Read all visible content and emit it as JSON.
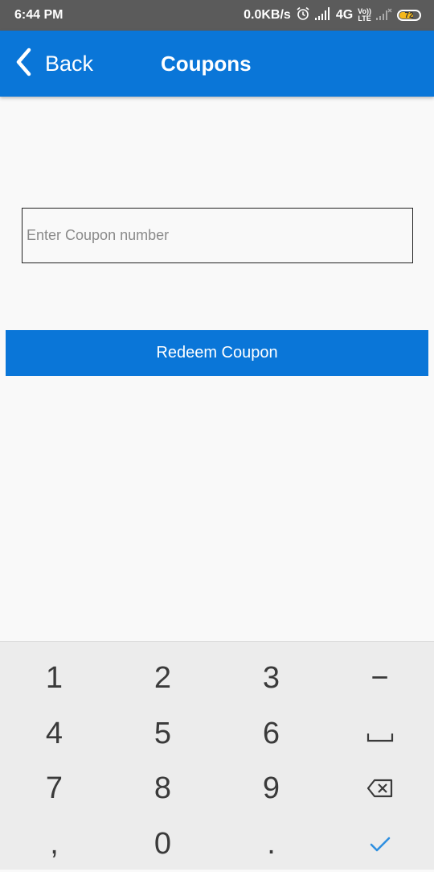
{
  "status_bar": {
    "time": "6:44 PM",
    "network_speed": "0.0KB/s",
    "network_type": "4G",
    "volte_line1": "Vo))",
    "volte_line2": "LTE",
    "battery_level": "72"
  },
  "app_bar": {
    "back_label": "Back",
    "title": "Coupons",
    "color": "#0a76d8"
  },
  "coupon": {
    "placeholder": "Enter Coupon number",
    "value": ""
  },
  "redeem": {
    "label": "Redeem Coupon"
  },
  "keyboard": {
    "rows": [
      [
        "1",
        "2",
        "3",
        "−"
      ],
      [
        "4",
        "5",
        "6",
        "space"
      ],
      [
        "7",
        "8",
        "9",
        "backspace"
      ],
      [
        ",",
        "0",
        ".",
        "done"
      ]
    ],
    "accent_color": "#2f8fe0"
  }
}
